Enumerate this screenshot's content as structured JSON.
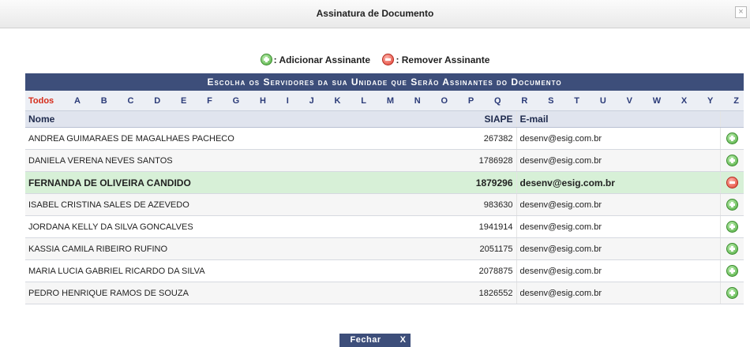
{
  "dialog": {
    "title": "Assinatura de Documento",
    "close_glyph": "×"
  },
  "legend": {
    "add_label": ": Adicionar Assinante",
    "remove_label": ": Remover Assinante"
  },
  "panel": {
    "caption": "Escolha os Servidores da sua Unidade que Serão Assinantes do Documento",
    "letters": [
      "Todos",
      "A",
      "B",
      "C",
      "D",
      "E",
      "F",
      "G",
      "H",
      "I",
      "J",
      "K",
      "L",
      "M",
      "N",
      "O",
      "P",
      "Q",
      "R",
      "S",
      "T",
      "U",
      "V",
      "W",
      "X",
      "Y",
      "Z"
    ],
    "columns": {
      "nome": "Nome",
      "siape": "SIAPE",
      "email": "E-mail"
    },
    "rows": [
      {
        "nome": "ANDREA GUIMARAES DE MAGALHAES PACHECO",
        "siape": "267382",
        "email": "desenv@esig.com.br",
        "action": "add"
      },
      {
        "nome": "DANIELA VERENA NEVES SANTOS",
        "siape": "1786928",
        "email": "desenv@esig.com.br",
        "action": "add"
      },
      {
        "nome": "FERNANDA DE OLIVEIRA CANDIDO",
        "siape": "1879296",
        "email": "desenv@esig.com.br",
        "action": "remove"
      },
      {
        "nome": "ISABEL CRISTINA SALES DE AZEVEDO",
        "siape": "983630",
        "email": "desenv@esig.com.br",
        "action": "add"
      },
      {
        "nome": "JORDANA KELLY DA SILVA GONCALVES",
        "siape": "1941914",
        "email": "desenv@esig.com.br",
        "action": "add"
      },
      {
        "nome": "KASSIA CAMILA RIBEIRO RUFINO",
        "siape": "2051175",
        "email": "desenv@esig.com.br",
        "action": "add"
      },
      {
        "nome": "MARIA LUCIA GABRIEL RICARDO DA SILVA",
        "siape": "2078875",
        "email": "desenv@esig.com.br",
        "action": "add"
      },
      {
        "nome": "PEDRO HENRIQUE RAMOS DE SOUZA",
        "siape": "1826552",
        "email": "desenv@esig.com.br",
        "action": "add"
      }
    ]
  },
  "footer": {
    "button_label": "Fechar",
    "button_glyph": "X"
  },
  "colors": {
    "header_bg": "#3d4e7a",
    "active_letter": "#d62c1a",
    "selected_row": "#d7f0d7",
    "add_icon": "#4daa3c",
    "remove_icon": "#e03a2c"
  },
  "icons": {
    "add": "plus-circle-icon",
    "remove": "minus-circle-icon"
  }
}
